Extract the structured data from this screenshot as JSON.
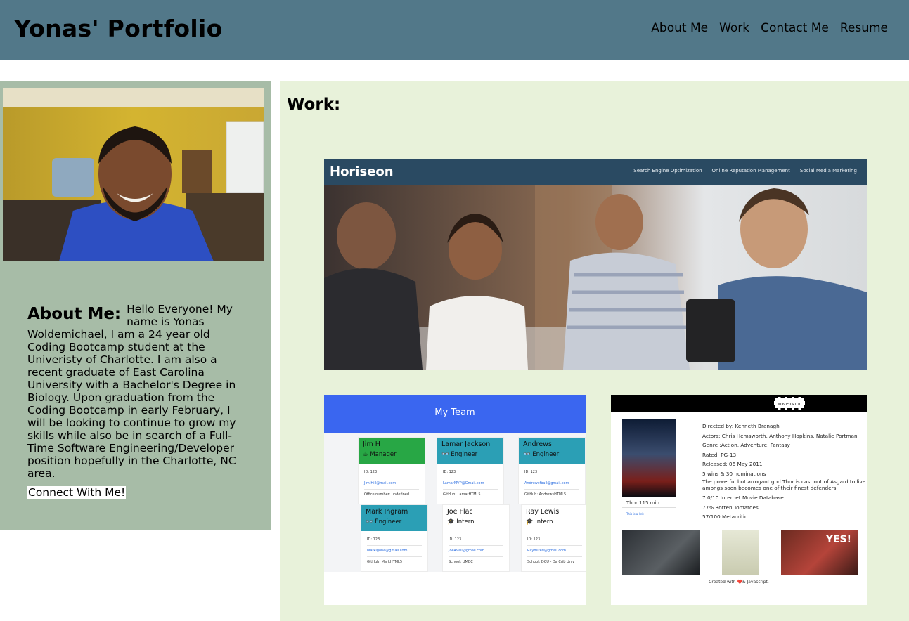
{
  "header": {
    "title": "Yonas' Portfolio",
    "nav": [
      "About Me",
      "Work",
      "Contact Me",
      "Resume"
    ]
  },
  "about": {
    "title": "About Me:",
    "text": "Hello Everyone! My name is Yonas Woldemichael, I am a 24 year old Coding Bootcamp student at the Univeristy of Charlotte. I am also a recent graduate of East Carolina University with a Bachelor's Degree in Biology. Upon graduation from the Coding Bootcamp in early February, I will be looking to continue to grow my skills while also be in search of a Full-Time Software Engineering/Developer position hopefully in the Charlotte, NC area.",
    "connect": "Connect With Me!"
  },
  "work": {
    "title": "Work:",
    "horiseon": {
      "logo": "Horiseon",
      "links": [
        "Search Engine Optimization",
        "Online Reputation Management",
        "Social Media Marketing"
      ]
    },
    "team": {
      "title": "My Team",
      "cards": [
        {
          "name": "Jim H",
          "role": "☕ Manager",
          "id": "ID: 123",
          "email": "Jim Hill@mail.com",
          "extra": "Office number: undefined"
        },
        {
          "name": "Lamar Jackson",
          "role": "👓 Engineer",
          "id": "ID: 123",
          "email": "LamarMVP@Gmail.com",
          "extra": "GitHub: LamarHTML5"
        },
        {
          "name": "Andrews",
          "role": "👓 Engineer",
          "id": "ID: 123",
          "email": "Andrewsfball@gmail.com",
          "extra": "GitHub: AndrewsHTML5"
        },
        {
          "name": "Mark Ingram",
          "role": "👓 Engineer",
          "id": "ID: 123",
          "email": "MarkIgone@gmail.com",
          "extra": "GitHub: MarkHTML5"
        },
        {
          "name": "Joe Flac",
          "role": "🎓 Intern",
          "id": "ID: 123",
          "email": "Joe49all@gmail.com",
          "extra": "School: UMBC"
        },
        {
          "name": "Ray Lewis",
          "role": "🎓 Intern",
          "id": "ID: 123",
          "email": "Raymlred@gmail.com",
          "extra": "School: DCU - Da Crib Univ"
        }
      ]
    },
    "movie": {
      "logo": "MOVIE CRITIC",
      "caption": "Thor 115 min",
      "link": "This is a link",
      "details": [
        "Directed by: Kenneth Branagh",
        "Actors: Chris Hemsworth, Anthony Hopkins, Natalie Portman",
        "Genre :Action, Adventure, Fantasy",
        "Rated: PG-13",
        "Released: 06 May 2011",
        "5 wins & 30 nominations"
      ],
      "plot": "The powerful but arrogant god Thor is cast out of Asgard to live amongs soon becomes one of their finest defenders.",
      "ratings": [
        "7.0/10 Internet Movie Database",
        "77% Rotten Tomatoes",
        "57/100 Metacritic"
      ],
      "yes": "YES!",
      "credit": "Created with ❤️& Javascript."
    }
  }
}
